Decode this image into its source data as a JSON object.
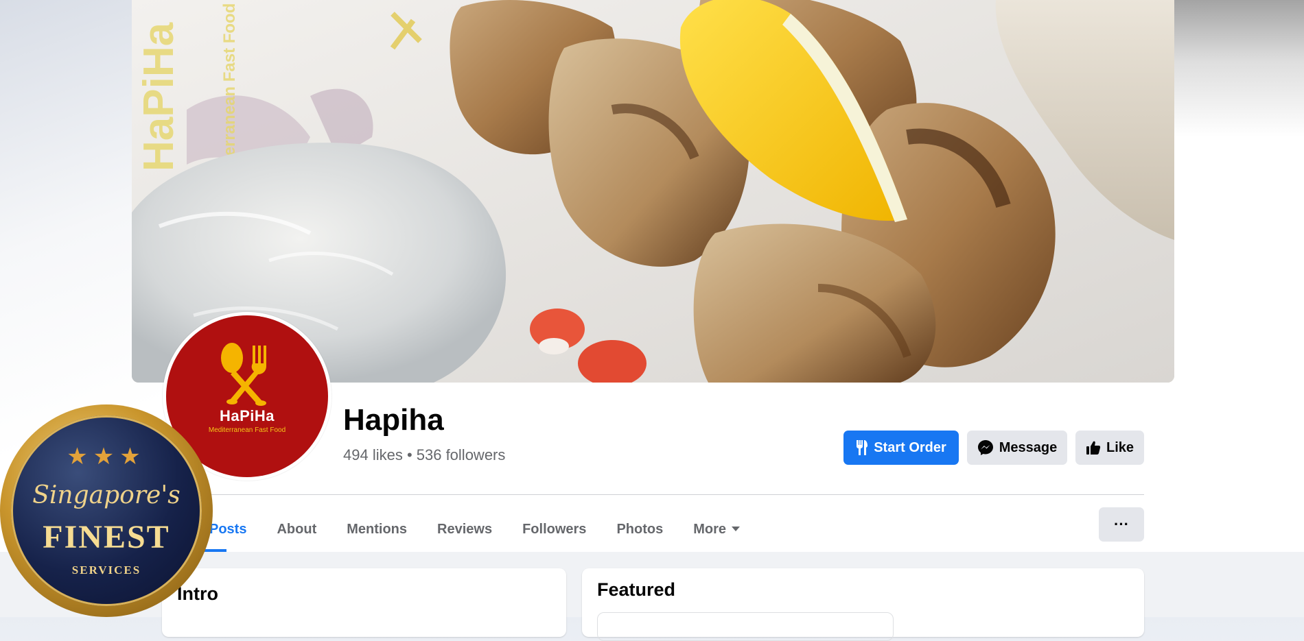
{
  "cover": {
    "watermark_brand": "HaPiHa",
    "watermark_tagline": "Mediterranean Fast Food"
  },
  "profile": {
    "logo_brand": "HaPiHa",
    "logo_tagline": "Mediterranean Fast Food",
    "name": "Hapiha",
    "stats": "494 likes • 536 followers"
  },
  "actions": {
    "start_order": "Start Order",
    "message": "Message",
    "like": "Like"
  },
  "tabs": [
    {
      "label": "Posts",
      "active": true
    },
    {
      "label": "About"
    },
    {
      "label": "Mentions"
    },
    {
      "label": "Reviews"
    },
    {
      "label": "Followers"
    },
    {
      "label": "Photos"
    },
    {
      "label": "More"
    }
  ],
  "more_menu_button": "···",
  "cards": {
    "intro_title": "Intro",
    "featured_title": "Featured"
  },
  "badge": {
    "stars": "★★★",
    "line1": "Singapore's",
    "line2": "FINEST",
    "line3": "SERVICES"
  },
  "colors": {
    "primary": "#1877f2",
    "logo_red": "#b01010",
    "badge_gold": "#c9952c",
    "badge_navy": "#16224a"
  }
}
